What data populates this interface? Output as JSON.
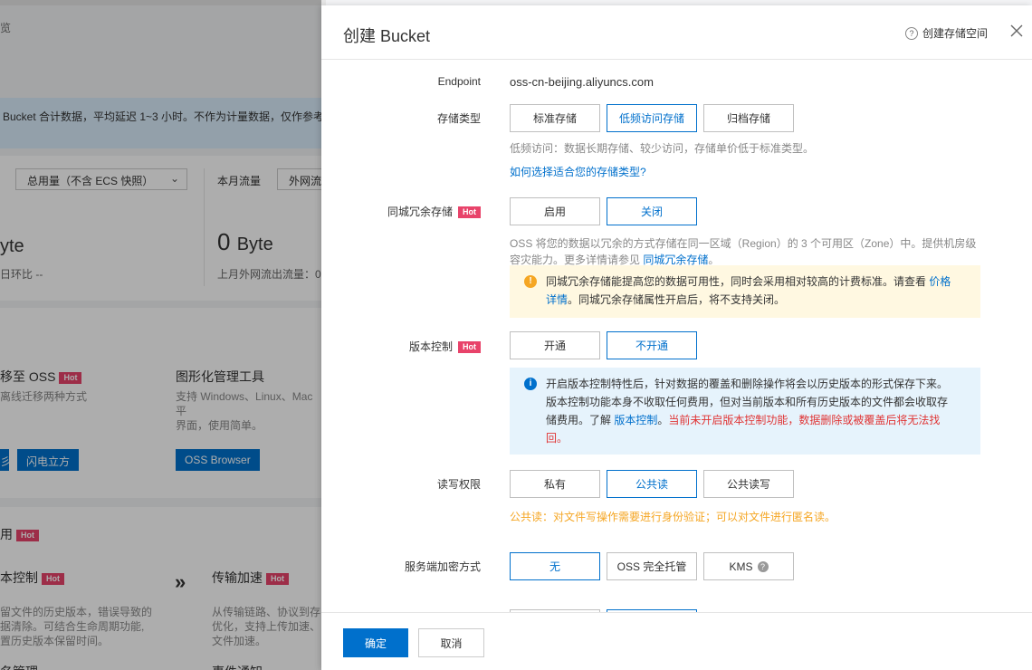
{
  "background": {
    "breadcrumb": "览",
    "notice": "Bucket 合计数据，平均延迟 1~3 小时。不作为计量数据，仅作参考",
    "usage_select": "总用量（不含 ECS 快照）",
    "monthly_traffic_label": "本月流量",
    "traffic_select": "外网流",
    "left_value_unit": "yte",
    "left_compare": "日环比 --",
    "right_value": "0",
    "right_unit": "Byte",
    "right_compare": "上月外网流出流量：0",
    "migrate_title": "移至 OSS",
    "migrate_desc": "离线迁移两种方式",
    "gui_title": "图形化管理工具",
    "gui_desc_1": "支持 Windows、Linux、Mac 平",
    "gui_desc_2": "界面，使用简单。",
    "btn_flash_partial": "彡",
    "btn_flash": "闪电立方",
    "btn_oss_browser": "OSS Browser",
    "section_char": "用",
    "version_title": "本控制",
    "version_desc_1": "留文件的历史版本，错误导致的",
    "version_desc_2": "据清除。可结合生命周期功能,",
    "version_desc_3": "置历史版本保留时间。",
    "accel_title": "传输加速",
    "accel_desc_1": "从传输链路、协议到存",
    "accel_desc_2": "优化，支持上传加速、",
    "accel_desc_3": "文件加速。",
    "bottom_left": "名管理",
    "bottom_right": "事件通知",
    "hot": "Hot"
  },
  "drawer": {
    "title": "创建 Bucket",
    "help_link": "创建存储空间",
    "endpoint_label": "Endpoint",
    "endpoint_value": "oss-cn-beijing.aliyuncs.com",
    "storage_label": "存储类型",
    "storage_options": [
      "标准存储",
      "低频访问存储",
      "归档存储"
    ],
    "storage_hint": "低频访问：数据长期存储、较少访问，存储单价低于标准类型。",
    "storage_link": "如何选择适合您的存储类型?",
    "redundancy_label": "同城冗余存储",
    "redundancy_options": [
      "启用",
      "关闭"
    ],
    "redundancy_hint_1": "OSS 将您的数据以冗余的方式存储在同一区域（Region）的 3 个可用区（Zone）中。提供机房级",
    "redundancy_hint_2": "容灾能力。更多详情请参见 ",
    "redundancy_hint_link": "同城冗余存储",
    "redundancy_hint_end": "。",
    "redundancy_alert_1": "同城冗余存储能提高您的数据可用性，同时会采用相对较高的计费标准。请查看 ",
    "redundancy_alert_link_1": "价格",
    "redundancy_alert_link_2": "详情",
    "redundancy_alert_2": "。同城冗余存储属性开启后，将不支持关闭。",
    "version_label": "版本控制",
    "version_options": [
      "开通",
      "不开通"
    ],
    "version_alert_1": "开启版本控制特性后，针对数据的覆盖和删除操作将会以历史版本的形式保存下来。",
    "version_alert_2": "版本控制功能本身不收取任何费用，但对当前版本和所有历史版本的文件都会收取存",
    "version_alert_3": "储费用。了解 ",
    "version_alert_link": "版本控制",
    "version_alert_mid": "。",
    "version_alert_red_1": "当前未开启版本控制功能，数据删除或被覆盖后将无法找",
    "version_alert_red_2": "回。",
    "acl_label": "读写权限",
    "acl_options": [
      "私有",
      "公共读",
      "公共读写"
    ],
    "acl_hint": "公共读：对文件写操作需要进行身份验证；可以对文件进行匿名读。",
    "encrypt_label": "服务端加密方式",
    "encrypt_options": [
      "无",
      "OSS 完全托管",
      "KMS"
    ],
    "hot": "Hot",
    "ok": "确定",
    "cancel": "取消"
  },
  "colors": {
    "primary": "#0070cc",
    "hot": "#e8436a",
    "warning": "#f5a623",
    "danger": "#e03535"
  }
}
